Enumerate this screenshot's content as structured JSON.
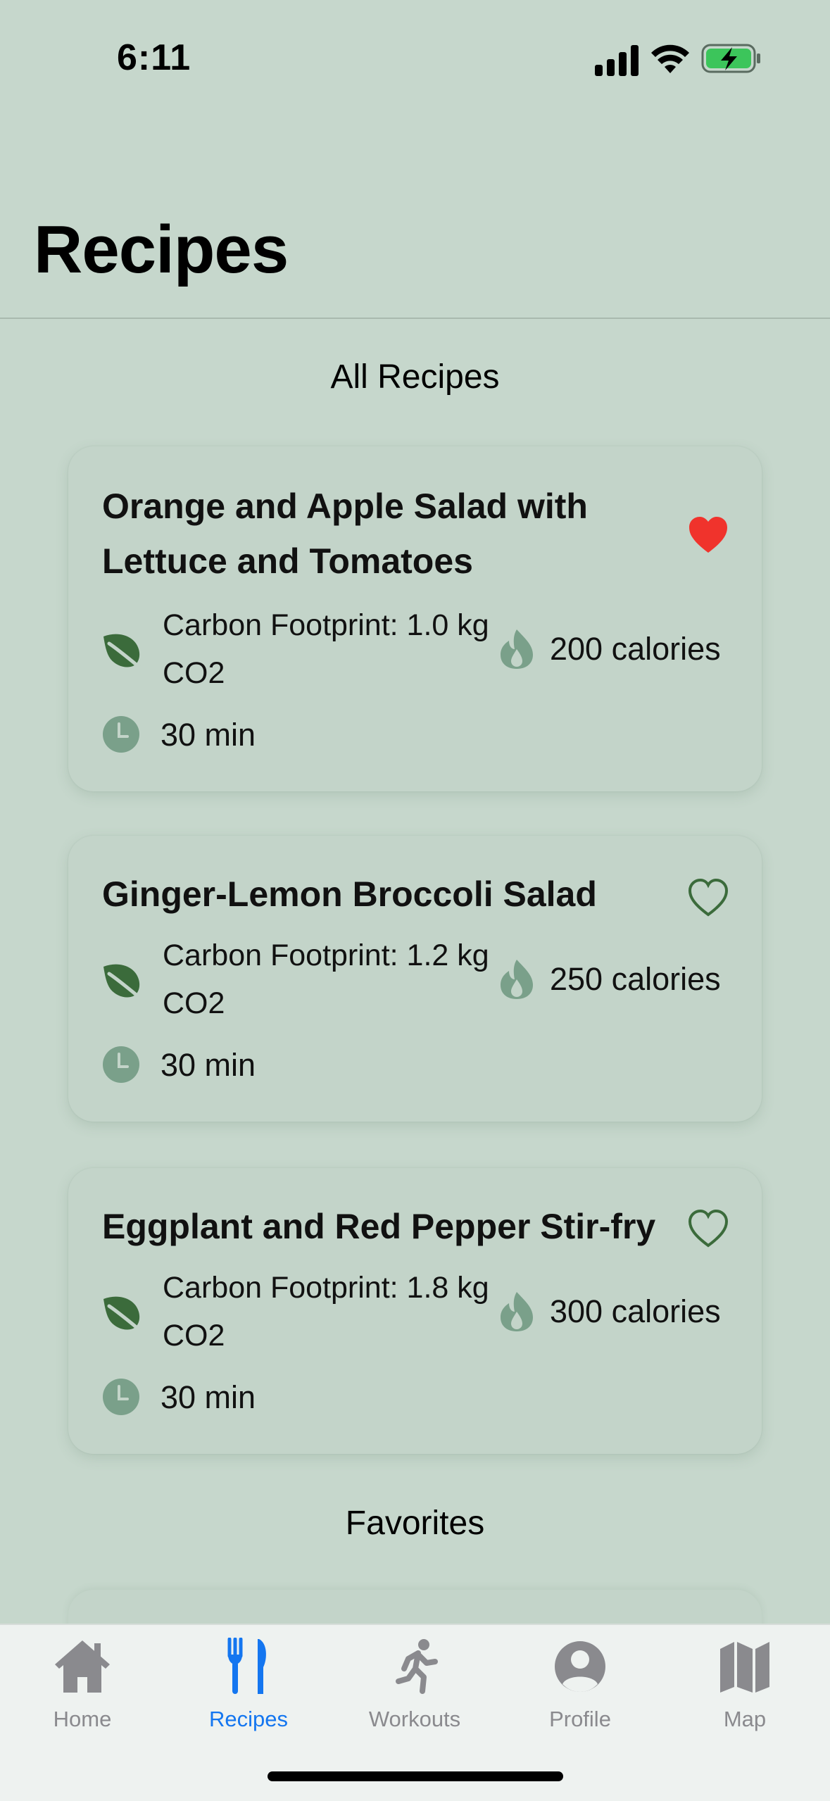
{
  "status_bar": {
    "time": "6:11"
  },
  "page": {
    "title": "Recipes"
  },
  "sections": {
    "all_recipes": "All Recipes",
    "favorites": "Favorites"
  },
  "recipes": [
    {
      "title": "Orange and Apple Salad with Lettuce and Tomatoes",
      "carbon": "Carbon Footprint: 1.0 kg CO2",
      "calories": "200 calories",
      "time": "30 min",
      "favorite": true
    },
    {
      "title": "Ginger-Lemon Broccoli Salad",
      "carbon": "Carbon Footprint: 1.2 kg CO2",
      "calories": "250 calories",
      "time": "30 min",
      "favorite": false
    },
    {
      "title": "Eggplant and Red Pepper Stir-fry",
      "carbon": "Carbon Footprint: 1.8 kg CO2",
      "calories": "300 calories",
      "time": "30 min",
      "favorite": false
    }
  ],
  "tabs": [
    {
      "label": "Home",
      "icon": "house-icon"
    },
    {
      "label": "Recipes",
      "icon": "fork-knife-icon",
      "active": true
    },
    {
      "label": "Workouts",
      "icon": "running-figure-icon"
    },
    {
      "label": "Profile",
      "icon": "person-circle-icon"
    },
    {
      "label": "Map",
      "icon": "map-icon"
    }
  ],
  "colors": {
    "background": "#c6d7cc",
    "card": "#c3d4c9",
    "leaf": "#3b6b3b",
    "muted_icon": "#7aa08a",
    "favorite_active": "#f0332c",
    "tab_active": "#1476f0",
    "tab_inactive": "#8a8a8e"
  }
}
